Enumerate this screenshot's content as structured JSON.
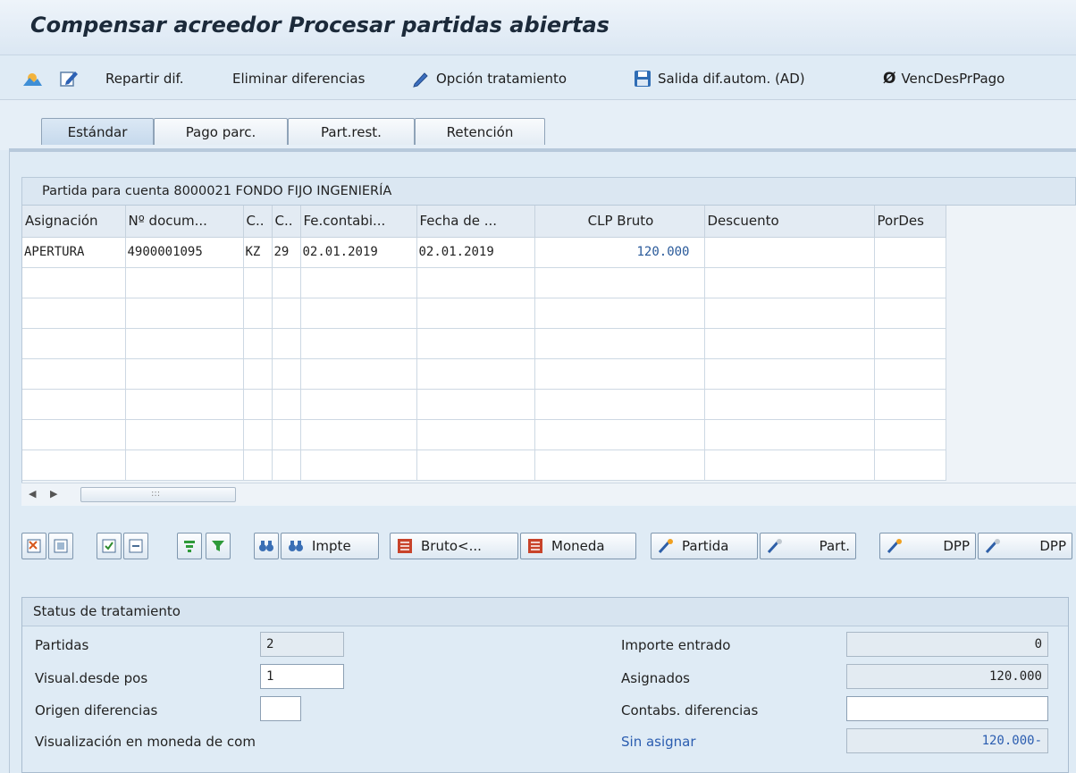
{
  "window": {
    "title": "Compensar acreedor Procesar partidas abiertas"
  },
  "toolbar": {
    "repartir": "Repartir dif.",
    "eliminar": "Eliminar diferencias",
    "opcion": "Opción tratamiento",
    "salida": "Salida dif.autom. (AD)",
    "venc": "VencDesPrPago"
  },
  "tabs": [
    "Estándar",
    "Pago parc.",
    "Part.rest.",
    "Retención"
  ],
  "grid": {
    "title": "Partida para cuenta 8000021 FONDO FIJO INGENIERÍA",
    "columns": [
      "Asignación",
      "Nº docum...",
      "C..",
      "C..",
      "Fe.contabi...",
      "Fecha de ...",
      "CLP Bruto",
      "Descuento",
      "PorDes"
    ],
    "rows": [
      [
        "APERTURA",
        "4900001095",
        "KZ",
        "29",
        "02.01.2019",
        "02.01.2019",
        "120.000",
        "",
        ""
      ]
    ]
  },
  "buttons": {
    "impte": "Impte",
    "bruto": "Bruto<...",
    "moneda": "Moneda",
    "partida": "Partida",
    "part": "Part.",
    "dpp1": "DPP",
    "dpp2": "DPP"
  },
  "status": {
    "title": "Status de tratamiento",
    "partidas_label": "Partidas",
    "partidas_value": "2",
    "visual_label": "Visual.desde pos",
    "visual_value": "1",
    "origen_label": "Origen diferencias",
    "origen_value": "",
    "moneda_label": "Visualización en moneda de com",
    "importe_label": "Importe entrado",
    "importe_value": "0",
    "asignados_label": "Asignados",
    "asignados_value": "120.000",
    "contabs_label": "Contabs. diferencias",
    "contabs_value": "",
    "sin_label": "Sin asignar",
    "sin_value": "120.000-"
  },
  "colors": {
    "link": "#2b5db0",
    "background": "#dfebf5",
    "amount": "#2a5a9a"
  }
}
